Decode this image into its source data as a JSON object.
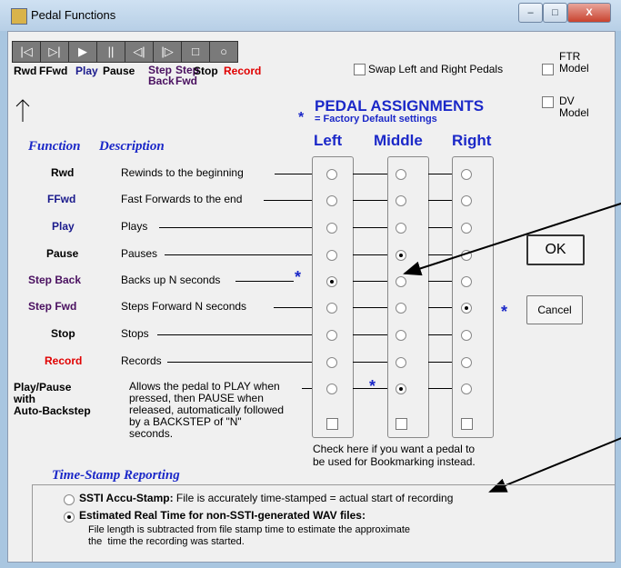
{
  "window": {
    "title": "Pedal Functions",
    "min_label": "–",
    "max_label": "□",
    "close_label": "X"
  },
  "toolbar": {
    "buttons": [
      "|◁",
      "▷|",
      "▶",
      "||",
      "◁|",
      "|▷",
      "□",
      "○"
    ],
    "labels": {
      "rwd": "Rwd",
      "ffwd": "FFwd",
      "play": "Play",
      "pause": "Pause",
      "step_back": "Step\nBack",
      "step_fwd": "Step\nFwd",
      "stop": "Stop",
      "record": "Record"
    }
  },
  "options": {
    "swap": "Swap Left and Right Pedals",
    "ftr": "FTR\nModel",
    "dv": "DV\nModel"
  },
  "assign": {
    "title": "PEDAL ASSIGNMENTS",
    "note": "= Factory Default settings",
    "star": "*",
    "left": "Left",
    "middle": "Middle",
    "right": "Right"
  },
  "headers": {
    "function": "Function",
    "description": "Description"
  },
  "rows": [
    {
      "name": "Rwd",
      "desc": "Rewinds to the beginning",
      "sel": -1
    },
    {
      "name": "FFwd",
      "desc": "Fast Forwards to the end",
      "sel": -1
    },
    {
      "name": "Play",
      "desc": "Plays",
      "sel": -1
    },
    {
      "name": "Pause",
      "desc": "Pauses",
      "sel": 1
    },
    {
      "name": "Step Back",
      "desc": "Backs up N seconds",
      "sel": 0
    },
    {
      "name": "Step Fwd",
      "desc": "Steps Forward N seconds",
      "sel": 2
    },
    {
      "name": "Stop",
      "desc": "Stops",
      "sel": -1
    },
    {
      "name": "Record",
      "desc": "Records",
      "sel": -1
    },
    {
      "name": "Play/Pause\nwith\nAuto-Backstep",
      "desc": "Allows the pedal to PLAY when\npressed, then PAUSE when\nreleased, automatically followed\nby a BACKSTEP of \"N\"\nseconds.",
      "sel": 1
    }
  ],
  "bookmark_note": "Check here if you want a pedal to\nbe used for Bookmarking instead.",
  "buttons": {
    "ok": "OK",
    "cancel": "Cancel"
  },
  "timestamp": {
    "title": "Time-Stamp Reporting",
    "opt1_bold": "SSTI Accu-Stamp:",
    "opt1_rest": " File is accurately time-stamped = actual start of recording",
    "opt2": "Estimated Real Time for non-SSTI-generated  WAV files:",
    "opt2_desc": "File length is subtracted from file stamp time to estimate the approximate\nthe  time the recording was started."
  },
  "colors": {
    "accent": "#1b28c8",
    "record": "#e00000",
    "step": "#4a1060"
  }
}
